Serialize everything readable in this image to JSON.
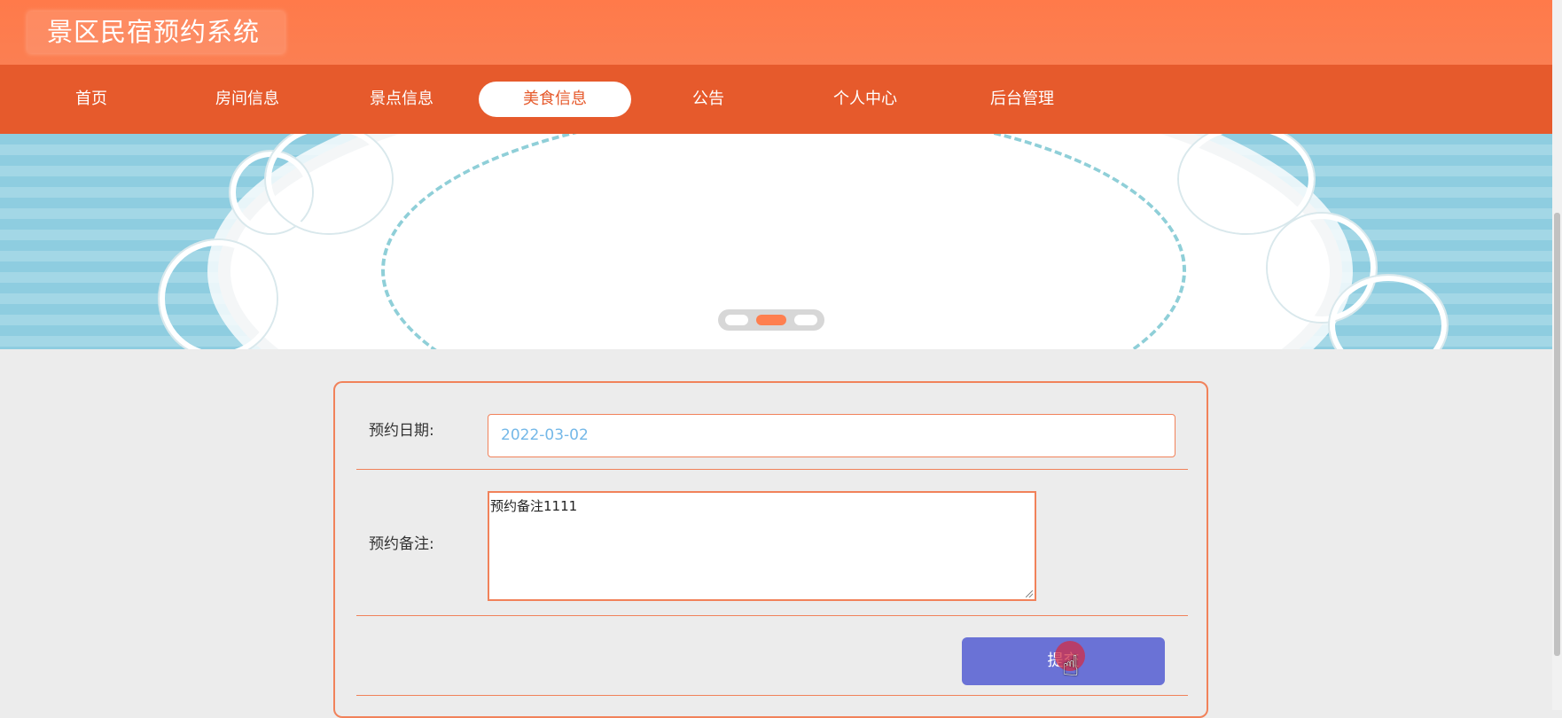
{
  "app": {
    "title": "景区民宿预约系统"
  },
  "nav": {
    "items": [
      {
        "label": "首页"
      },
      {
        "label": "房间信息"
      },
      {
        "label": "景点信息"
      },
      {
        "label": "美食信息"
      },
      {
        "label": "公告"
      },
      {
        "label": "个人中心"
      },
      {
        "label": "后台管理"
      }
    ],
    "active_index": 3
  },
  "carousel": {
    "active_slide": 2,
    "slide_count": 3
  },
  "form": {
    "date_label": "预约日期:",
    "date_value": "2022-03-02",
    "note_label": "预约备注:",
    "note_value": "预约备注1111",
    "submit_label": "提交"
  },
  "colors": {
    "header": "#fb7f52",
    "nav": "#e65a2c",
    "accent": "#f1825a",
    "submit": "#6a72d6",
    "date_text": "#74b8e8"
  },
  "icons": {
    "cursor": "hand-pointer-icon"
  }
}
